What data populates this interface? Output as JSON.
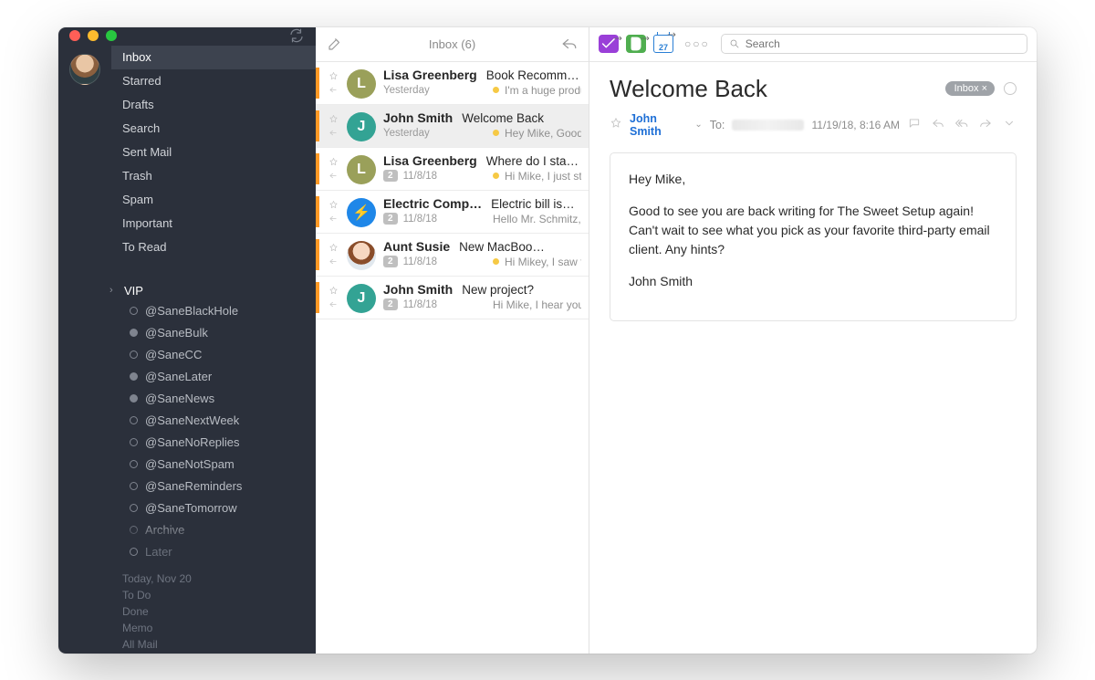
{
  "sidebar": {
    "folders": [
      {
        "label": "Inbox",
        "active": true
      },
      {
        "label": "Starred",
        "active": false
      },
      {
        "label": "Drafts",
        "active": false
      },
      {
        "label": "Search",
        "active": false
      },
      {
        "label": "Sent Mail",
        "active": false
      },
      {
        "label": "Trash",
        "active": false
      },
      {
        "label": "Spam",
        "active": false
      },
      {
        "label": "Important",
        "active": false
      },
      {
        "label": "To Read",
        "active": false
      }
    ],
    "vip_label": "VIP",
    "tags": [
      "@SaneBlackHole",
      "@SaneBulk",
      "@SaneCC",
      "@SaneLater",
      "@SaneNews",
      "@SaneNextWeek",
      "@SaneNoReplies",
      "@SaneNotSpam",
      "@SaneReminders",
      "@SaneTomorrow",
      "Archive",
      "Later"
    ],
    "footer": [
      "Today, Nov 20",
      "To Do",
      "Done",
      "Memo",
      "All Mail"
    ]
  },
  "list": {
    "title": "Inbox (6)",
    "items": [
      {
        "sender": "Lisa Greenberg",
        "subject": "Book Recomme…",
        "date": "Yesterday",
        "preview": "I'm a huge producti…",
        "count": null,
        "ydot": true,
        "avatar": "L",
        "avclass": "av-olive",
        "selected": false
      },
      {
        "sender": "John Smith",
        "subject": "Welcome Back",
        "date": "Yesterday",
        "preview": "Hey Mike, Good to…",
        "count": null,
        "ydot": true,
        "avatar": "J",
        "avclass": "av-teal",
        "selected": true
      },
      {
        "sender": "Lisa Greenberg",
        "subject": "Where do I sta…",
        "date": "11/8/18",
        "preview": "Hi Mike, I just starte…",
        "count": "2",
        "ydot": true,
        "avatar": "L",
        "avclass": "av-olive",
        "selected": false
      },
      {
        "sender": "Electric Comp…",
        "subject": "Electric bill is…",
        "date": "11/8/18",
        "preview": "Hello Mr. Schmitz,…",
        "count": "2",
        "ydot": false,
        "avatar": "⚡",
        "avclass": "av-blue",
        "selected": false
      },
      {
        "sender": "Aunt Susie",
        "subject": "New MacBoo…",
        "date": "11/8/18",
        "preview": "Hi Mikey, I saw the…",
        "count": "2",
        "ydot": true,
        "avatar": "",
        "avclass": "av-face",
        "selected": false
      },
      {
        "sender": "John Smith",
        "subject": "New project?",
        "date": "11/8/18",
        "preview": "Hi Mike, I hear you'…",
        "count": "2",
        "ydot": false,
        "avatar": "J",
        "avclass": "av-teal",
        "selected": false
      }
    ]
  },
  "reader": {
    "search_placeholder": "Search",
    "calendar_day": "27",
    "subject": "Welcome Back",
    "tag_pill": "Inbox ×",
    "from": "John Smith",
    "to_label": "To:",
    "date": "11/19/18, 8:16 AM",
    "body": {
      "p1": "Hey Mike,",
      "p2": "Good to see you are back writing for The Sweet Setup again! Can't wait to see what you pick as your favorite third-party email client. Any hints?",
      "p3": "John Smith"
    }
  }
}
